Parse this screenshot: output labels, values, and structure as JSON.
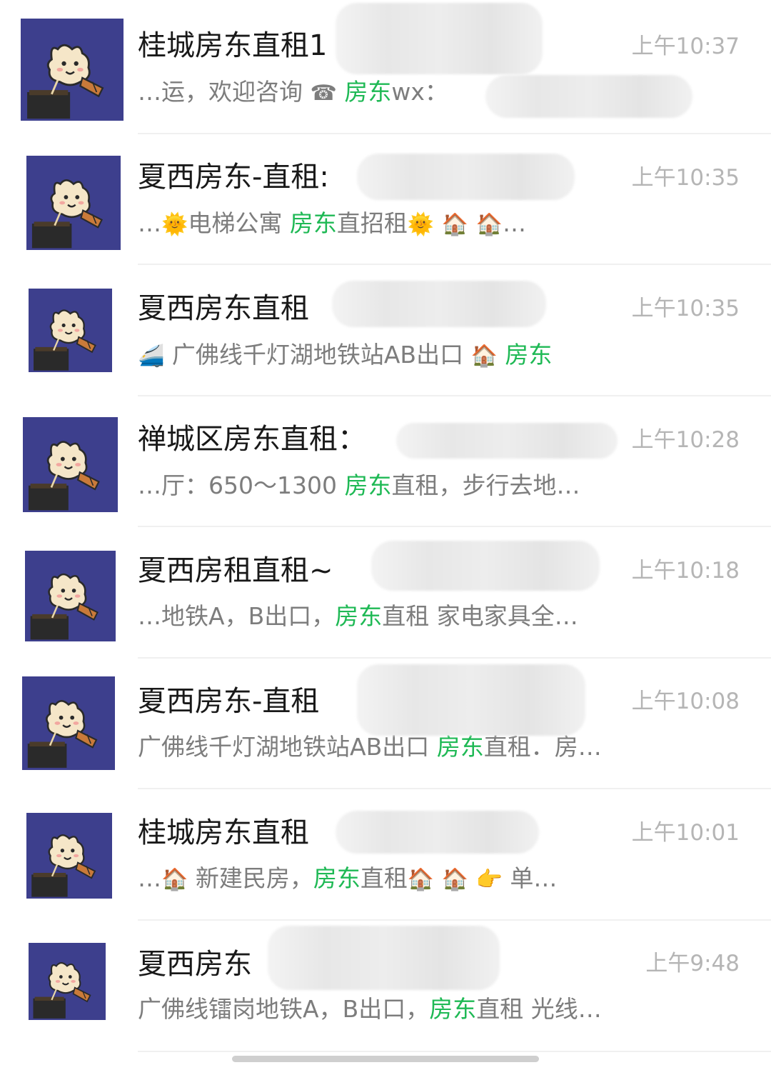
{
  "chats": [
    {
      "name": "桂城房东直租1",
      "time": "上午10:37",
      "preview": [
        {
          "t": "…运，欢迎咨询 "
        },
        {
          "t": "☎",
          "kind": "emoji",
          "icon": "telephone-icon"
        },
        {
          "t": " "
        },
        {
          "t": "房东",
          "kind": "kw"
        },
        {
          "t": "wx："
        }
      ]
    },
    {
      "name": "夏西房东-直租:",
      "time": "上午10:35",
      "preview": [
        {
          "t": "…"
        },
        {
          "t": "🌞",
          "kind": "emoji",
          "icon": "sun-icon"
        },
        {
          "t": "电梯公寓 "
        },
        {
          "t": "房东",
          "kind": "kw"
        },
        {
          "t": "直招租"
        },
        {
          "t": "🌞",
          "kind": "emoji",
          "icon": "sun-icon"
        },
        {
          "t": "  "
        },
        {
          "t": "🏠",
          "kind": "emoji",
          "icon": "house-icon"
        },
        {
          "t": " "
        },
        {
          "t": "🏠",
          "kind": "emoji",
          "icon": "house-icon"
        },
        {
          "t": "…"
        }
      ]
    },
    {
      "name": "夏西房东直租",
      "time": "上午10:35",
      "preview": [
        {
          "t": "🚄",
          "kind": "emoji",
          "icon": "train-icon"
        },
        {
          "t": " 广佛线千灯湖地铁站AB出口 "
        },
        {
          "t": "🏠",
          "kind": "emoji",
          "icon": "house-icon"
        },
        {
          "t": " "
        },
        {
          "t": "房东",
          "kind": "kw"
        }
      ]
    },
    {
      "name": "禅城区房东直租：",
      "time": "上午10:28",
      "preview": [
        {
          "t": "…厅：650～1300 "
        },
        {
          "t": "房东",
          "kind": "kw"
        },
        {
          "t": "直租，步行去地…"
        }
      ]
    },
    {
      "name": "夏西房租直租~",
      "time": "上午10:18",
      "preview": [
        {
          "t": "…地铁A，B出口，"
        },
        {
          "t": "房东",
          "kind": "kw"
        },
        {
          "t": "直租 家电家具全…"
        }
      ]
    },
    {
      "name": "夏西房东-直租",
      "time": "上午10:08",
      "preview": [
        {
          "t": "广佛线千灯湖地铁站AB出口 "
        },
        {
          "t": "房东",
          "kind": "kw"
        },
        {
          "t": "直租．房…"
        }
      ]
    },
    {
      "name": "桂城房东直租",
      "time": "上午10:01",
      "preview": [
        {
          "t": "…"
        },
        {
          "t": "🏠",
          "kind": "emoji",
          "icon": "house-icon"
        },
        {
          "t": "  新建民房，"
        },
        {
          "t": "房东",
          "kind": "kw"
        },
        {
          "t": "直租"
        },
        {
          "t": "🏠",
          "kind": "emoji",
          "icon": "house-icon"
        },
        {
          "t": " "
        },
        {
          "t": "🏠",
          "kind": "emoji",
          "icon": "house-icon"
        },
        {
          "t": "  "
        },
        {
          "t": "👉",
          "kind": "emoji",
          "icon": "pointing-hand-icon"
        },
        {
          "t": " 单…"
        }
      ]
    },
    {
      "name": "夏西房东",
      "time": "上午9:48",
      "preview": [
        {
          "t": "广佛线镭岗地铁A，B出口，"
        },
        {
          "t": "房东",
          "kind": "kw"
        },
        {
          "t": "直租 光线…"
        }
      ]
    }
  ],
  "colors": {
    "keyword": "#1fb955",
    "avatar_bg": "#3d3f8d",
    "time": "#b5b5b5",
    "preview": "#7d7d7d"
  }
}
